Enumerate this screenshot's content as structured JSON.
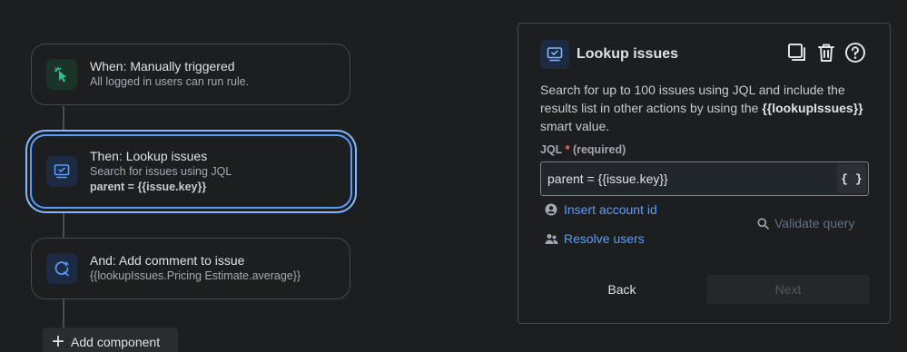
{
  "flow": {
    "trigger": {
      "title": "When: Manually triggered",
      "subtitle": "All logged in users can run rule.",
      "icon": "cursor-click-icon"
    },
    "action": {
      "title": "Then: Lookup issues",
      "subtitle": "Search for issues using JQL",
      "detail": "parent = {{issue.key}}",
      "icon": "lookup-issues-icon"
    },
    "comment": {
      "title": "And: Add comment to issue",
      "subtitle": "{{lookupIssues.Pricing Estimate.average}}",
      "icon": "comment-icon"
    },
    "add_component": "Add component"
  },
  "panel": {
    "title": "Lookup issues",
    "desc_1": "Search for up to 100 issues using JQL and include the results list in other actions by using the ",
    "desc_bold": "{{lookupIssues}}",
    "desc_2": " smart value.",
    "jql_label": "JQL",
    "jql_required_mark": "*",
    "jql_required_text": "(required)",
    "jql_value": "parent = {{issue.key}}",
    "braces": "{ }",
    "insert_account": "Insert account id",
    "resolve_users": "Resolve users",
    "validate": "Validate query",
    "back": "Back",
    "next": "Next"
  },
  "colors": {
    "accent": "#579dff",
    "trigger_icon": "#2dc28f",
    "background": "#1d1e20"
  }
}
